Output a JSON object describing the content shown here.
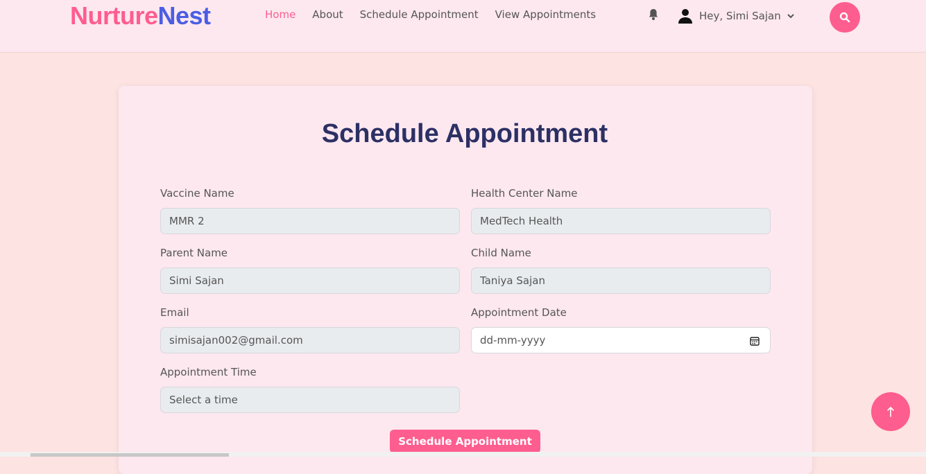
{
  "brand": {
    "part1": "Nurture",
    "part2": "Nest"
  },
  "nav": {
    "home": "Home",
    "about": "About",
    "schedule": "Schedule Appointment",
    "view": "View Appointments"
  },
  "user": {
    "greeting": "Hey, Simi Sajan"
  },
  "form": {
    "title": "Schedule Appointment",
    "vaccine_label": "Vaccine Name",
    "vaccine_value": "MMR 2",
    "center_label": "Health Center Name",
    "center_value": "MedTech Health",
    "parent_label": "Parent Name",
    "parent_value": "Simi Sajan",
    "child_label": "Child Name",
    "child_value": "Taniya Sajan",
    "email_label": "Email",
    "email_value": "simisajan002@gmail.com",
    "date_label": "Appointment Date",
    "date_placeholder": "dd-mm-yyyy",
    "time_label": "Appointment Time",
    "time_value": "Select a time",
    "submit_label": "Schedule Appointment"
  },
  "icons": {
    "bell": "bell-icon",
    "user": "user-icon",
    "caret": "chevron-down-icon",
    "search": "search-icon",
    "calendar": "calendar-icon",
    "scroll_top": "arrow-up-icon"
  },
  "colors": {
    "accent": "#fe5d8f",
    "brand_blue": "#4b5de4",
    "title": "#2c3064"
  }
}
